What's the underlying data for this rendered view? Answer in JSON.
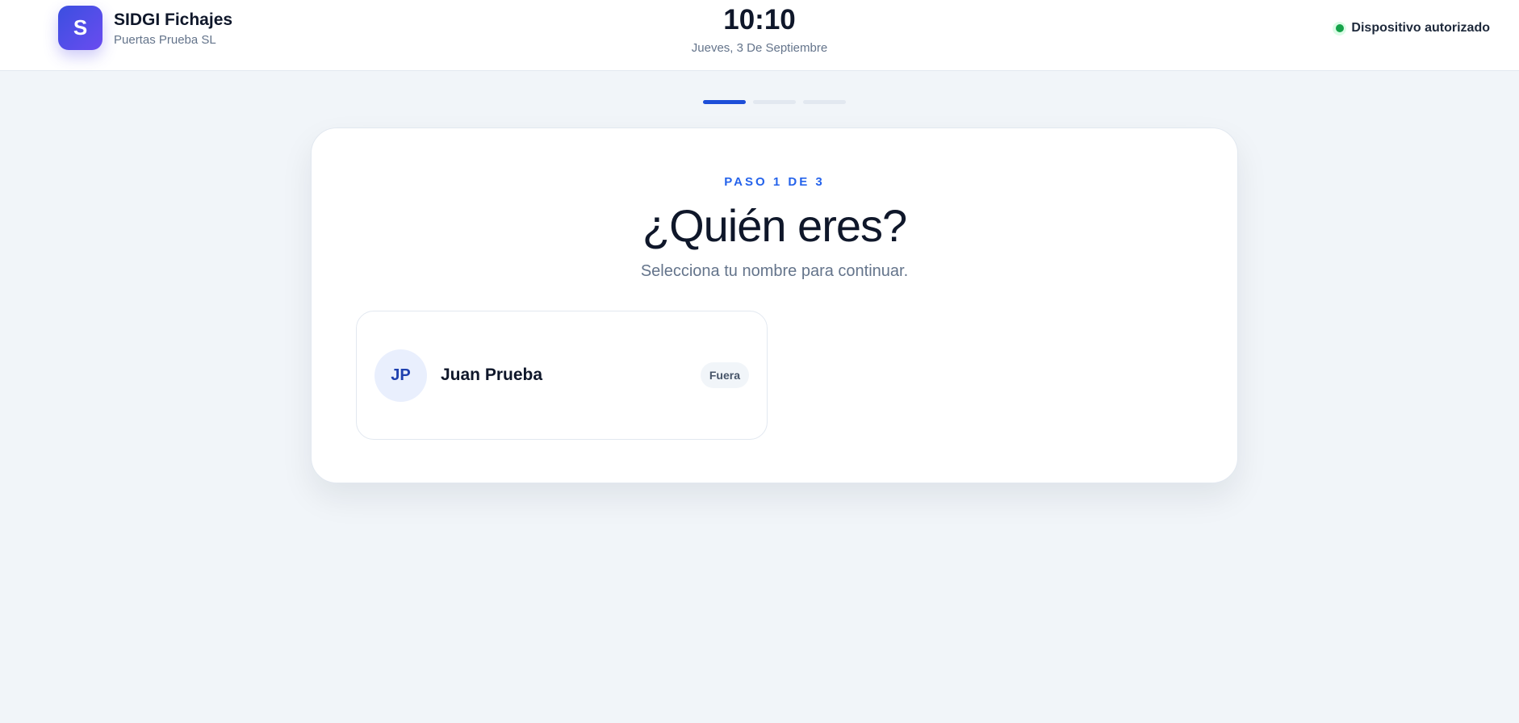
{
  "header": {
    "logo_letter": "S",
    "app_name": "SIDGI Fichajes",
    "company": "Puertas Prueba SL",
    "time": "10:10",
    "date": "Jueves, 3 De Septiembre",
    "device_status": "Dispositivo autorizado",
    "device_status_color": "#16a34a"
  },
  "progress": {
    "current_step": 1,
    "total_steps": 3,
    "active_color": "#1d4ed8"
  },
  "card": {
    "eyebrow": "PASO 1 DE 3",
    "title": "¿Quién eres?",
    "subtitle": "Selecciona tu nombre para continuar."
  },
  "employees": [
    {
      "initials": "JP",
      "name": "Juan Prueba",
      "status": "Fuera"
    }
  ]
}
